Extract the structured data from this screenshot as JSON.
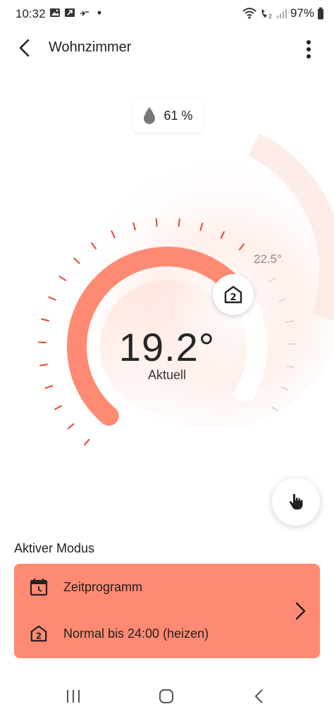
{
  "status_bar": {
    "time": "10:32",
    "battery_percent": "97%",
    "icons_left": [
      "gallery-icon",
      "phone-link-icon",
      "transfer-icon",
      "dot-icon"
    ],
    "icons_right": [
      "wifi-icon",
      "wifi-calling-icon",
      "signal-icon",
      "battery-icon"
    ]
  },
  "header": {
    "title": "Wohnzimmer",
    "back_icon": "chevron-left-icon",
    "menu_icon": "more-vert-icon"
  },
  "humidity": {
    "value": "61 %",
    "icon": "water-drop-icon"
  },
  "thermostat": {
    "current_temp": "19.2°",
    "current_label": "Aktuell",
    "target_temp": "22.5°",
    "target_icon": "home-2-icon",
    "arc_min": 5,
    "arc_max": 30,
    "current_value": 19.2,
    "target_value": 22.5
  },
  "manual_button": {
    "icon": "hand-pointer-icon"
  },
  "mode": {
    "title": "Aktiver Modus",
    "schedule_label": "Zeitprogramm",
    "schedule_icon": "calendar-clock-icon",
    "detail_label": "Normal bis 24:00 (heizen)",
    "detail_icon": "home-2-icon",
    "chevron_icon": "chevron-right-icon"
  },
  "nav_bar": {
    "items": [
      "recents-icon",
      "home-icon",
      "back-icon"
    ]
  },
  "colors": {
    "accent": "#ff8a73",
    "tick_active": "#e8452c",
    "tick_inactive": "#d9d9d9",
    "text": "#1f1f1f"
  }
}
